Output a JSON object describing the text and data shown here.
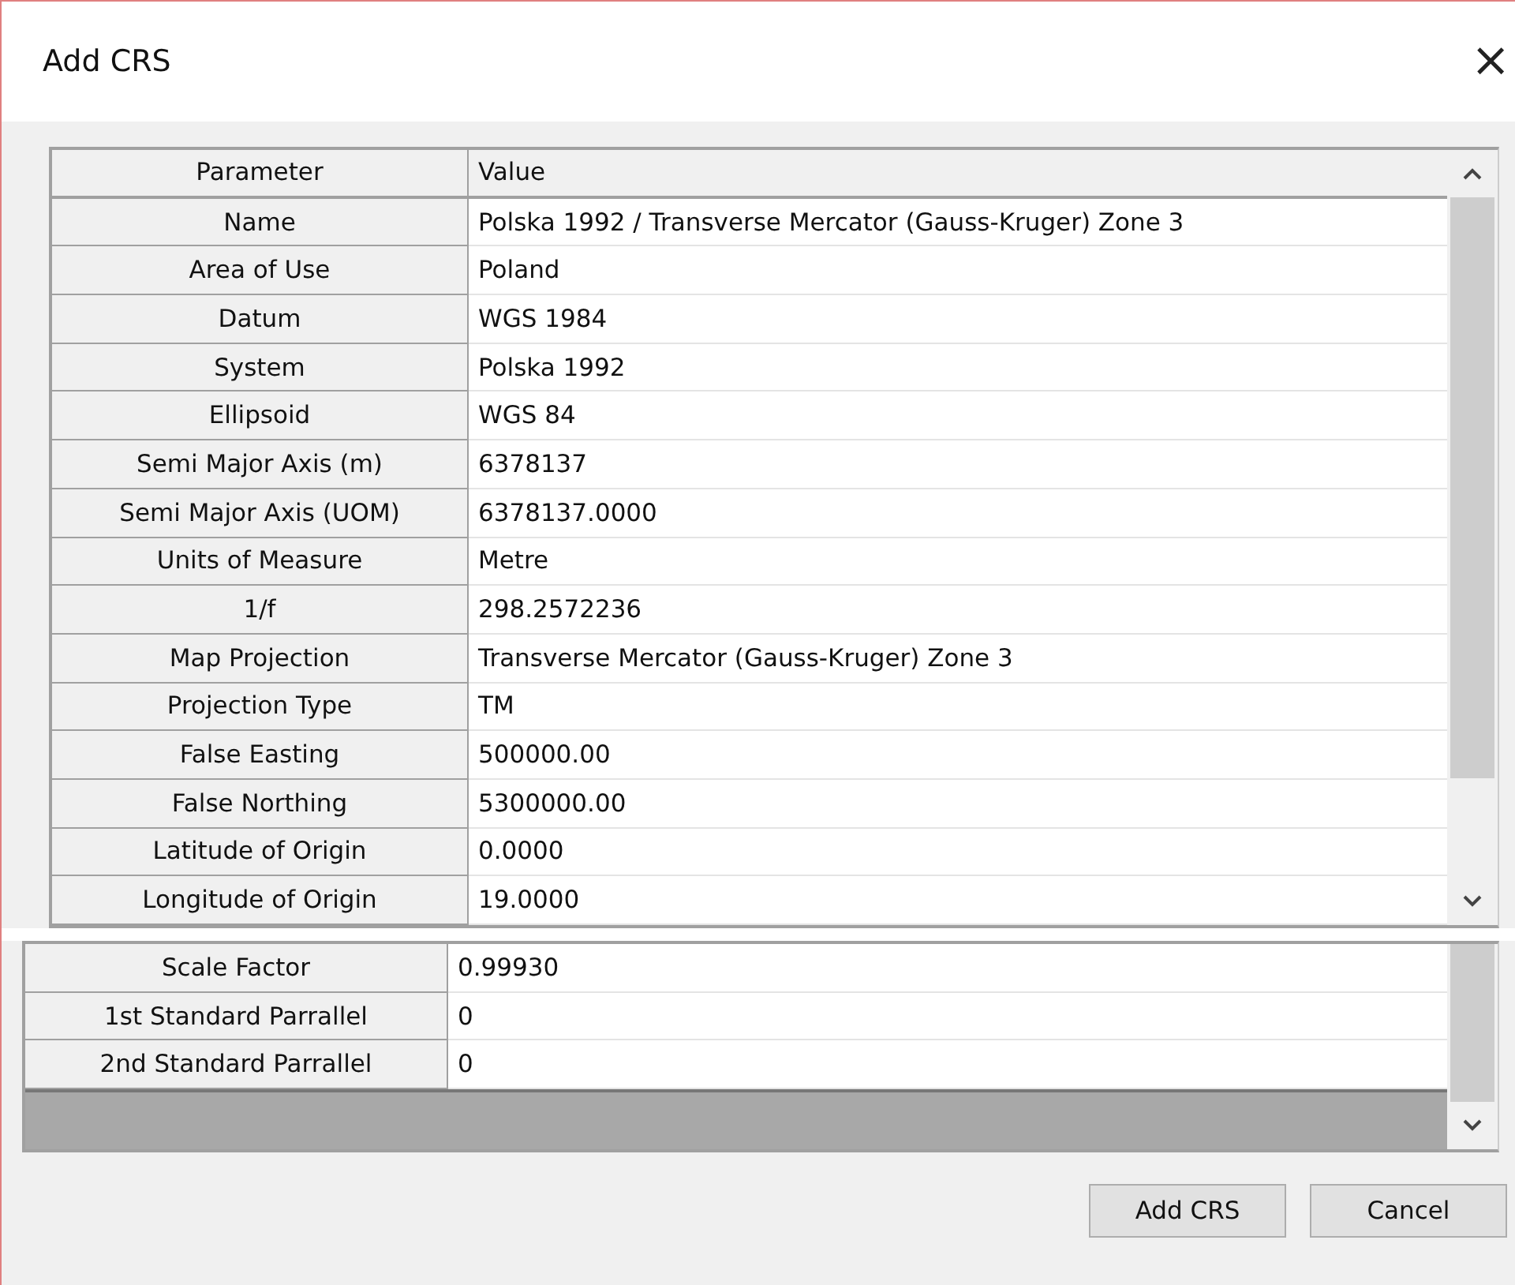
{
  "window": {
    "title": "Add CRS",
    "close": "×"
  },
  "table": {
    "columns": [
      "Parameter",
      "Value"
    ],
    "rows": [
      {
        "parameter": "Name",
        "value": "Polska 1992 / Transverse Mercator (Gauss-Kruger) Zone 3"
      },
      {
        "parameter": "Area of Use",
        "value": "Poland"
      },
      {
        "parameter": "Datum",
        "value": "WGS 1984"
      },
      {
        "parameter": "System",
        "value": "Polska 1992"
      },
      {
        "parameter": "Ellipsoid",
        "value": "WGS 84"
      },
      {
        "parameter": "Semi Major Axis (m)",
        "value": "6378137"
      },
      {
        "parameter": "Semi Major Axis (UOM)",
        "value": "6378137.0000"
      },
      {
        "parameter": "Units of Measure",
        "value": "Metre"
      },
      {
        "parameter": "1/f",
        "value": "298.2572236"
      },
      {
        "parameter": "Map Projection",
        "value": "Transverse Mercator (Gauss-Kruger) Zone 3"
      },
      {
        "parameter": "Projection Type",
        "value": "TM"
      },
      {
        "parameter": "False Easting",
        "value": "500000.00"
      },
      {
        "parameter": "False Northing",
        "value": "5300000.00"
      },
      {
        "parameter": "Latitude of Origin",
        "value": "0.0000"
      },
      {
        "parameter": "Longitude of Origin",
        "value": "19.0000"
      }
    ]
  },
  "table_continued": {
    "rows": [
      {
        "parameter": "Scale Factor",
        "value": "0.99930"
      },
      {
        "parameter": "1st Standard Parrallel",
        "value": "0"
      },
      {
        "parameter": "2nd Standard Parrallel",
        "value": "0"
      }
    ]
  },
  "buttons": [
    "Add CRS",
    "Cancel"
  ]
}
